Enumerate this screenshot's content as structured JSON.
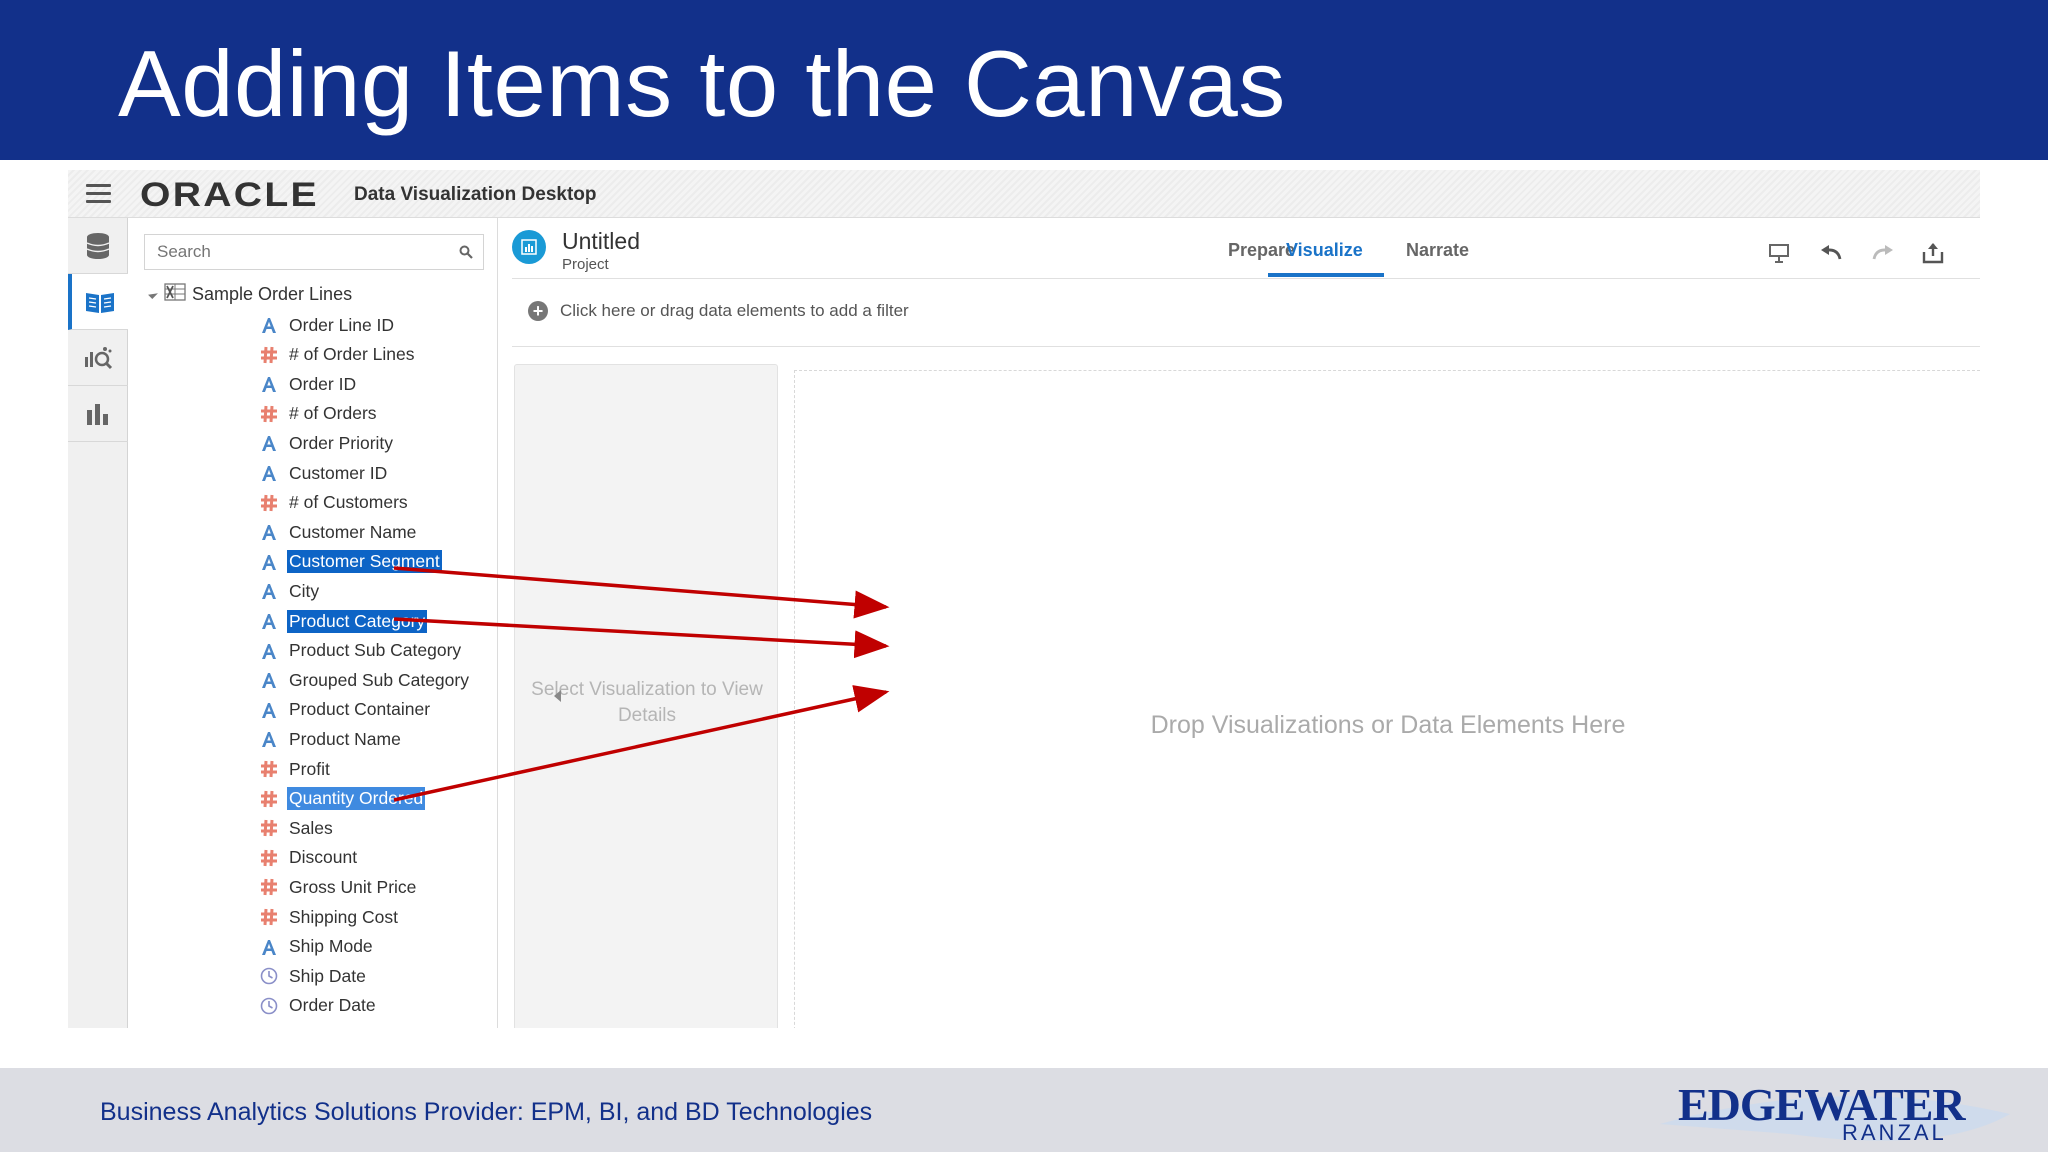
{
  "slide": {
    "title": "Adding Items to the Canvas",
    "footer": "Business Analytics Solutions Provider:  EPM, BI, and BD Technologies",
    "brand_main": "EDGEWATER",
    "brand_sub": "RANZAL"
  },
  "app": {
    "logo": "ORACLE",
    "product": "Data Visualization Desktop"
  },
  "rail": {
    "icons": [
      "database-icon",
      "book-icon",
      "explore-icon",
      "bar-chart-icon"
    ],
    "active_index": 1
  },
  "data_panel": {
    "search_placeholder": "Search",
    "dataset": "Sample Order Lines",
    "fields": [
      {
        "label": "Order Line ID",
        "type": "attribute"
      },
      {
        "label": "# of Order Lines",
        "type": "measure"
      },
      {
        "label": "Order ID",
        "type": "attribute"
      },
      {
        "label": "# of Orders",
        "type": "measure"
      },
      {
        "label": "Order Priority",
        "type": "attribute"
      },
      {
        "label": "Customer ID",
        "type": "attribute"
      },
      {
        "label": "# of Customers",
        "type": "measure"
      },
      {
        "label": "Customer Name",
        "type": "attribute"
      },
      {
        "label": "Customer Segment",
        "type": "attribute",
        "selected": true
      },
      {
        "label": "City",
        "type": "attribute"
      },
      {
        "label": "Product Category",
        "type": "attribute",
        "selected": true
      },
      {
        "label": "Product Sub Category",
        "type": "attribute"
      },
      {
        "label": "Grouped Sub Category",
        "type": "attribute"
      },
      {
        "label": "Product Container",
        "type": "attribute"
      },
      {
        "label": "Product Name",
        "type": "attribute"
      },
      {
        "label": "Profit",
        "type": "measure"
      },
      {
        "label": "Quantity Ordered",
        "type": "measure",
        "selected": true
      },
      {
        "label": "Sales",
        "type": "measure"
      },
      {
        "label": "Discount",
        "type": "measure"
      },
      {
        "label": "Gross Unit Price",
        "type": "measure"
      },
      {
        "label": "Shipping Cost",
        "type": "measure"
      },
      {
        "label": "Ship Mode",
        "type": "attribute"
      },
      {
        "label": "Ship Date",
        "type": "time"
      },
      {
        "label": "Order Date",
        "type": "time"
      }
    ]
  },
  "canvas": {
    "project_title": "Untitled",
    "project_subtitle": "Project",
    "tabs": [
      "Prepare",
      "Visualize",
      "Narrate"
    ],
    "active_tab": "Visualize",
    "filter_hint": "Click here or drag data elements to add a filter",
    "props_hint": "Select Visualization to View Details",
    "drop_hint": "Drop Visualizations or Data Elements Here",
    "tools": [
      "present-icon",
      "undo-icon",
      "redo-icon",
      "export-icon"
    ]
  },
  "colors": {
    "title_bar": "#12308a",
    "accent": "#1a73c8",
    "selection": "#0d64c6",
    "arrow": "#c00000",
    "attribute_icon": "#4a86c8",
    "measure_icon": "#e8806f"
  }
}
